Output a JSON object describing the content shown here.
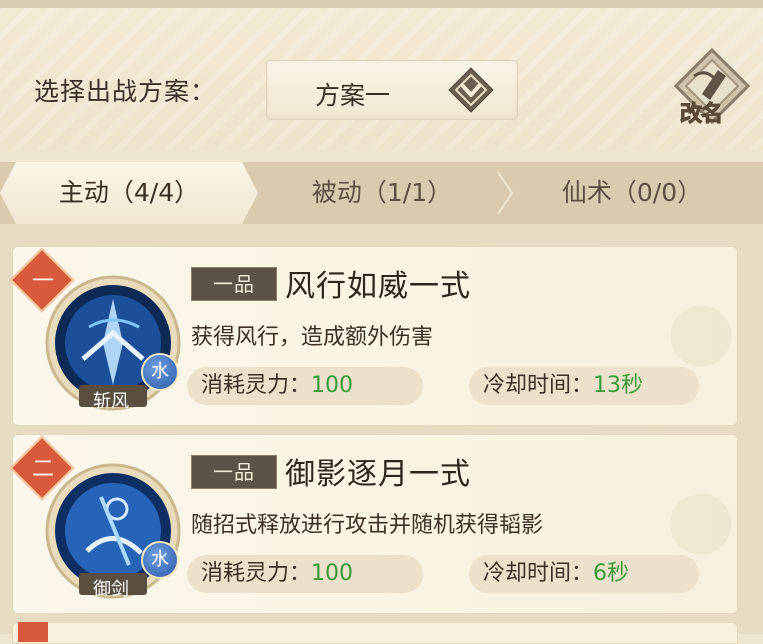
{
  "plan": {
    "label": "选择出战方案：",
    "selected": "方案一",
    "rename_label": "改名"
  },
  "tabs": [
    {
      "label": "主动（4/4）",
      "active": true
    },
    {
      "label": "被动（1/1）",
      "active": false
    },
    {
      "label": "仙术（0/0）",
      "active": false
    }
  ],
  "skills": [
    {
      "rank": "一",
      "icon_label": "斩风",
      "element": "水",
      "grade": "一品",
      "name": "风行如威一式",
      "desc": "获得风行，造成额外伤害",
      "cost_label": "消耗灵力：",
      "cost_value": "100",
      "cooldown_label": "冷却时间：",
      "cooldown_value": "13秒",
      "icon": "wind-slash-icon"
    },
    {
      "rank": "二",
      "icon_label": "御剑",
      "element": "水",
      "grade": "一品",
      "name": "御影逐月一式",
      "desc": "随招式释放进行攻击并随机获得韬影",
      "cost_label": "消耗灵力：",
      "cost_value": "100",
      "cooldown_label": "冷却时间：",
      "cooldown_value": "6秒",
      "icon": "flying-sword-icon"
    }
  ],
  "colors": {
    "accent_red": "#d9593c",
    "value_green": "#3a9a3a",
    "element_blue": "#2c5aa8"
  }
}
